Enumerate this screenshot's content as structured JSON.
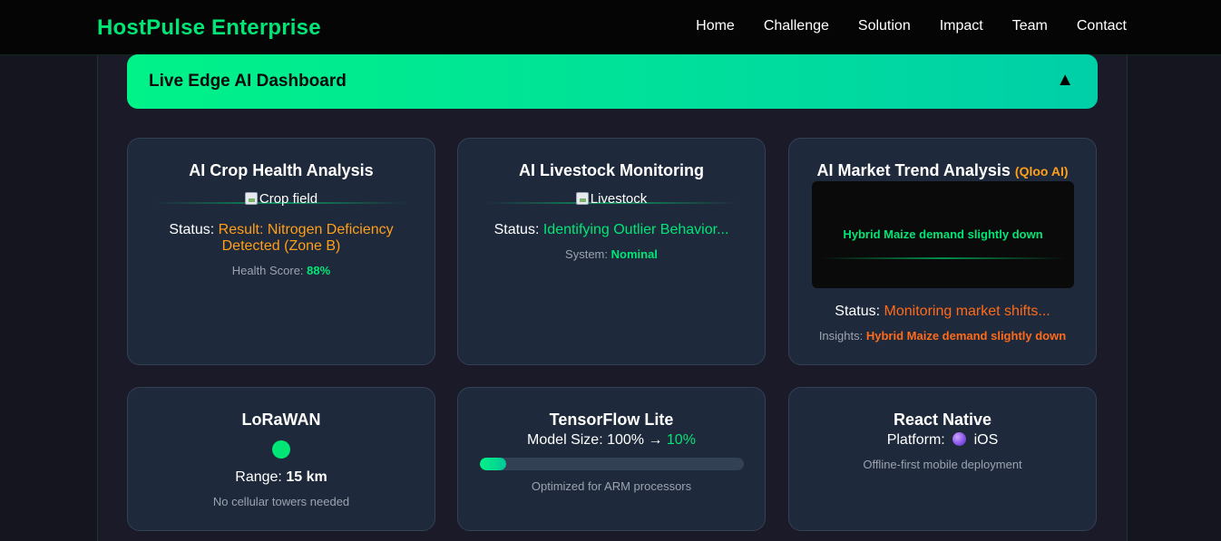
{
  "nav": {
    "brand": "HostPulse Enterprise",
    "links": [
      "Home",
      "Challenge",
      "Solution",
      "Impact",
      "Team",
      "Contact"
    ]
  },
  "dashboard": {
    "title": "Live Edge AI Dashboard",
    "toggle": "▲"
  },
  "cards": {
    "crop": {
      "title": "AI Crop Health Analysis",
      "image_alt": "Crop field",
      "status_label": "Status:",
      "status_value_1": "Result: Nitrogen Deficiency",
      "status_value_2": "Detected (Zone B)",
      "metric_label": "Health Score:",
      "metric_value": "88%"
    },
    "livestock": {
      "title": "AI Livestock Monitoring",
      "image_alt": "Livestock",
      "status_label": "Status:",
      "status_value": "Identifying Outlier Behavior...",
      "metric_label": "System:",
      "metric_value": "Nominal"
    },
    "market": {
      "title": "AI Market Trend Analysis",
      "tag": "(Qloo AI)",
      "screen_text": "Hybrid Maize demand slightly down",
      "status_label": "Status:",
      "status_value": "Monitoring market shifts...",
      "metric_label": "Insights:",
      "metric_value": "Hybrid Maize demand slightly down"
    },
    "lorawan": {
      "title": "LoRaWAN",
      "range_label": "Range:",
      "range_value": "15 km",
      "note": "No cellular towers needed"
    },
    "tflite": {
      "title": "TensorFlow Lite",
      "size_label": "Model Size: 100% →",
      "size_value": "10%",
      "progress": 0.1,
      "note": "Optimized for ARM processors"
    },
    "react_native": {
      "title": "React Native",
      "platform_label": "Platform:",
      "platform_value": "iOS",
      "note": "Offline-first mobile deployment"
    }
  },
  "colors": {
    "accent": "#00e676",
    "orange": "#ff9f1a",
    "deep_orange": "#ff6b1a",
    "card_bg": "#1e293b"
  }
}
